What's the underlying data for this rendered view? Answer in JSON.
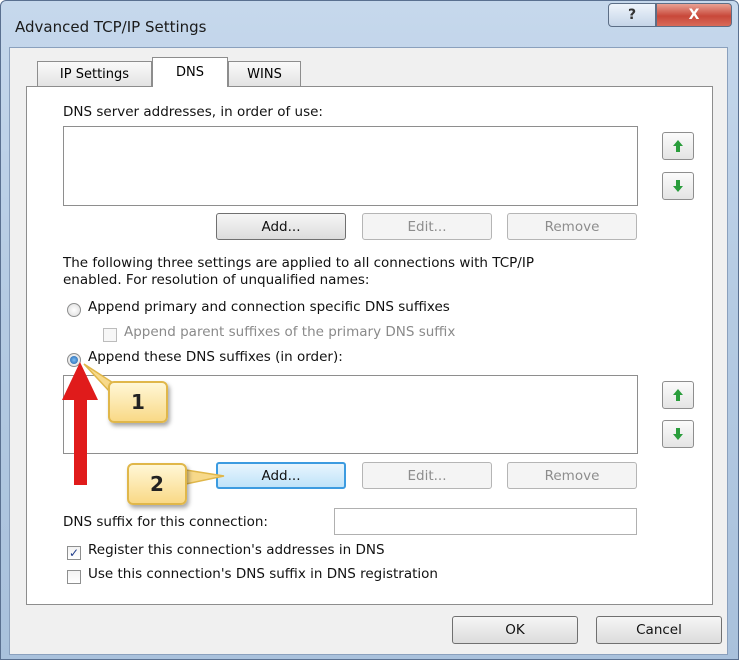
{
  "window": {
    "title": "Advanced TCP/IP Settings",
    "help_glyph": "?",
    "close_glyph": "X"
  },
  "tabs": [
    {
      "label": "IP Settings"
    },
    {
      "label": "DNS"
    },
    {
      "label": "WINS"
    }
  ],
  "dns_servers": {
    "label": "DNS server addresses, in order of use:",
    "items": [],
    "add_label": "Add...",
    "edit_label": "Edit...",
    "remove_label": "Remove"
  },
  "info_text_line1": "The following three settings are applied to all connections with TCP/IP",
  "info_text_line2": "enabled. For resolution of unqualified names:",
  "option_primary": {
    "label": "Append primary and connection specific DNS suffixes",
    "selected": false
  },
  "option_parent": {
    "label": "Append parent suffixes of the primary DNS suffix",
    "checked": false,
    "enabled": false
  },
  "option_these": {
    "label": "Append these DNS suffixes (in order):",
    "selected": true
  },
  "dns_suffixes": {
    "items": [],
    "add_label": "Add...",
    "edit_label": "Edit...",
    "remove_label": "Remove"
  },
  "connection_suffix": {
    "label": "DNS suffix for this connection:",
    "value": ""
  },
  "register": {
    "label": "Register this connection's addresses in DNS",
    "checked": true
  },
  "use_suffix": {
    "label": "Use this connection's DNS suffix in DNS registration",
    "checked": false
  },
  "footer": {
    "ok_label": "OK",
    "cancel_label": "Cancel"
  },
  "annotations": {
    "callout1": "1",
    "callout2": "2"
  },
  "colors": {
    "arrow_up": "#2a9d3c",
    "arrow_down": "#2a9d3c",
    "red_arrow": "#e01b1b",
    "focus": "#3c9be0"
  }
}
